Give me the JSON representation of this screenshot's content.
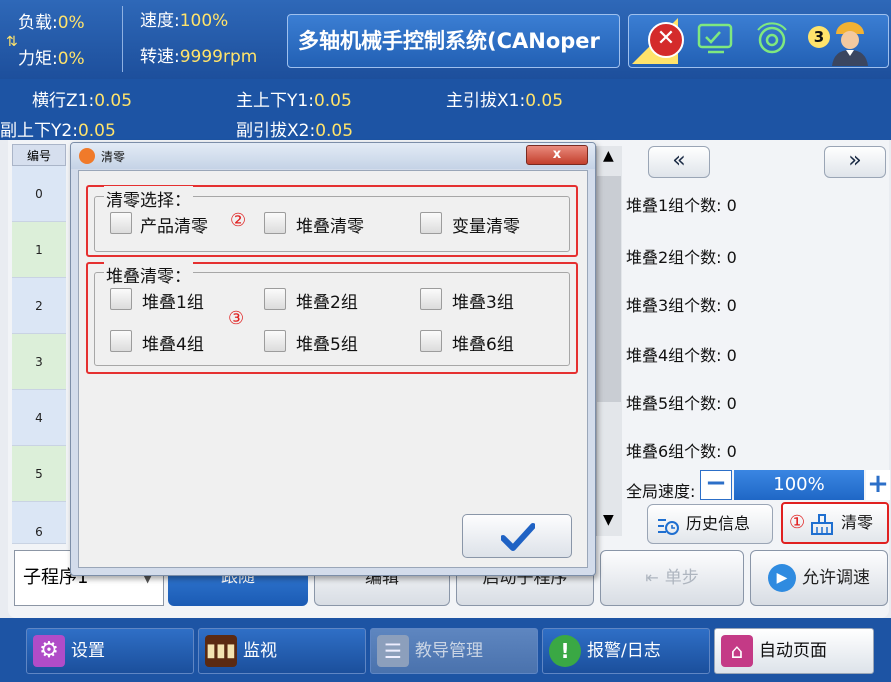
{
  "header": {
    "load_label": "负载:",
    "load_value": "0%",
    "speed_label": "速度:",
    "speed_value": "100%",
    "torque_label": "力矩:",
    "torque_value": "0%",
    "rpm_label": "转速:",
    "rpm_value": "9999rpm",
    "title": "多轴机械手控制系统(CANoper",
    "badge_count": "3"
  },
  "axes": [
    {
      "label": "横行Z1:",
      "value": "0.05"
    },
    {
      "label": "主上下Y1:",
      "value": "0.05"
    },
    {
      "label": "主引拔X1:",
      "value": "0.05"
    },
    {
      "label": "副上下Y2:",
      "value": "0.05"
    },
    {
      "label": "副引拔X2:",
      "value": "0.05"
    }
  ],
  "table": {
    "header": "编号",
    "rows": [
      "0",
      "1",
      "2",
      "3",
      "4",
      "5",
      "6"
    ]
  },
  "right": {
    "prev": "«",
    "next": "»",
    "stacks": [
      {
        "label": "堆叠1组个数:",
        "value": "0"
      },
      {
        "label": "堆叠2组个数:",
        "value": "0"
      },
      {
        "label": "堆叠3组个数:",
        "value": "0"
      },
      {
        "label": "堆叠4组个数:",
        "value": "0"
      },
      {
        "label": "堆叠5组个数:",
        "value": "0"
      },
      {
        "label": "堆叠6组个数:",
        "value": "0"
      }
    ],
    "speed_label": "全局速度:",
    "speed_value": "100%",
    "minus": "−",
    "plus": "+",
    "history": "历史信息",
    "clear": "清零",
    "clear_marker": "①"
  },
  "bottom_row": {
    "subprogram": "子程序1",
    "follow": "跟随",
    "edit": "编辑",
    "start_sub": "启动子程序",
    "step": "单步",
    "allow_debug": "允许调速"
  },
  "nav": {
    "settings": "设置",
    "monitor": "监视",
    "teach": "教导管理",
    "alarm": "报警/日志",
    "auto": "自动页面"
  },
  "dialog": {
    "title": "清零",
    "close": "x",
    "group1": {
      "legend": "清零选择：",
      "items": [
        "产品清零",
        "堆叠清零",
        "变量清零"
      ],
      "marker": "②"
    },
    "group2": {
      "legend": "堆叠清零：",
      "items": [
        "堆叠1组",
        "堆叠2组",
        "堆叠3组",
        "堆叠4组",
        "堆叠5组",
        "堆叠6组"
      ],
      "marker": "③"
    }
  },
  "colors": {
    "header_blue": "#1d54a4",
    "accent_yellow": "#ffe36b",
    "highlight_red": "#e53030",
    "row_even": "#dbe6f5",
    "row_odd": "#dcefd9"
  }
}
